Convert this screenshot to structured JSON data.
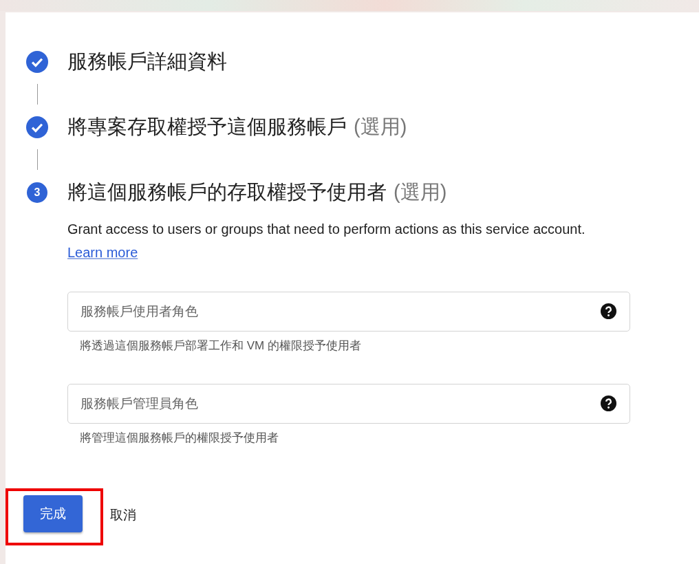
{
  "steps": [
    {
      "completed": true,
      "title": "服務帳戶詳細資料"
    },
    {
      "completed": true,
      "title": "將專案存取權授予這個服務帳戶",
      "suffix": "(選用)"
    },
    {
      "completed": false,
      "number": "3",
      "title": "將這個服務帳戶的存取權授予使用者",
      "suffix": "(選用)"
    }
  ],
  "description": "Grant access to users or groups that need to perform actions as this service account.",
  "learn_more": "Learn more",
  "fields": [
    {
      "placeholder": "服務帳戶使用者角色",
      "hint": "將透過這個服務帳戶部署工作和 VM 的權限授予使用者"
    },
    {
      "placeholder": "服務帳戶管理員角色",
      "hint": "將管理這個服務帳戶的權限授予使用者"
    }
  ],
  "buttons": [
    {
      "label": "完成",
      "kind": "primary",
      "highlighted": true
    },
    {
      "label": "取消",
      "kind": "text",
      "highlighted": false
    }
  ]
}
